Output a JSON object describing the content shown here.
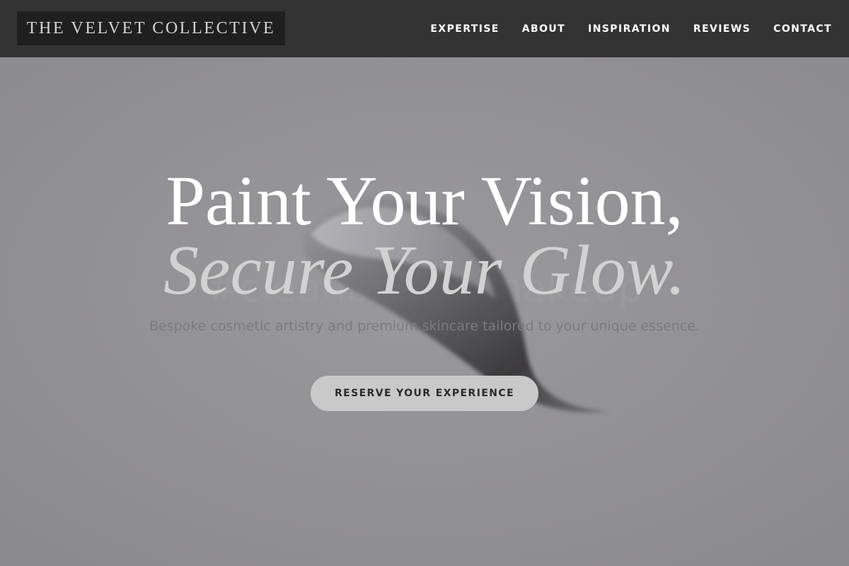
{
  "brand": {
    "name": "THE VELVET COLLECTIVE"
  },
  "nav": {
    "items": [
      {
        "label": "EXPERTISE"
      },
      {
        "label": "ABOUT"
      },
      {
        "label": "INSPIRATION"
      },
      {
        "label": "REVIEWS"
      },
      {
        "label": "CONTACT"
      }
    ]
  },
  "hero": {
    "headline_line1": "Paint Your Vision,",
    "headline_line2": "Secure Your Glow.",
    "subtitle": "Bespoke cosmetic artistry and premium skincare tailored to your unique essence.",
    "cta_label": "RESERVE YOUR EXPERIENCE",
    "background_image": "lipstick-swatch-photo"
  },
  "colors": {
    "header_bg": "#333333",
    "logo_bg": "#1f1f1f",
    "hero_overlay": "#929194",
    "headline_primary": "#ffffff",
    "headline_secondary": "#d2d2d2",
    "cta_bg": "#c9c9ca",
    "cta_text": "#2b2b2b"
  }
}
